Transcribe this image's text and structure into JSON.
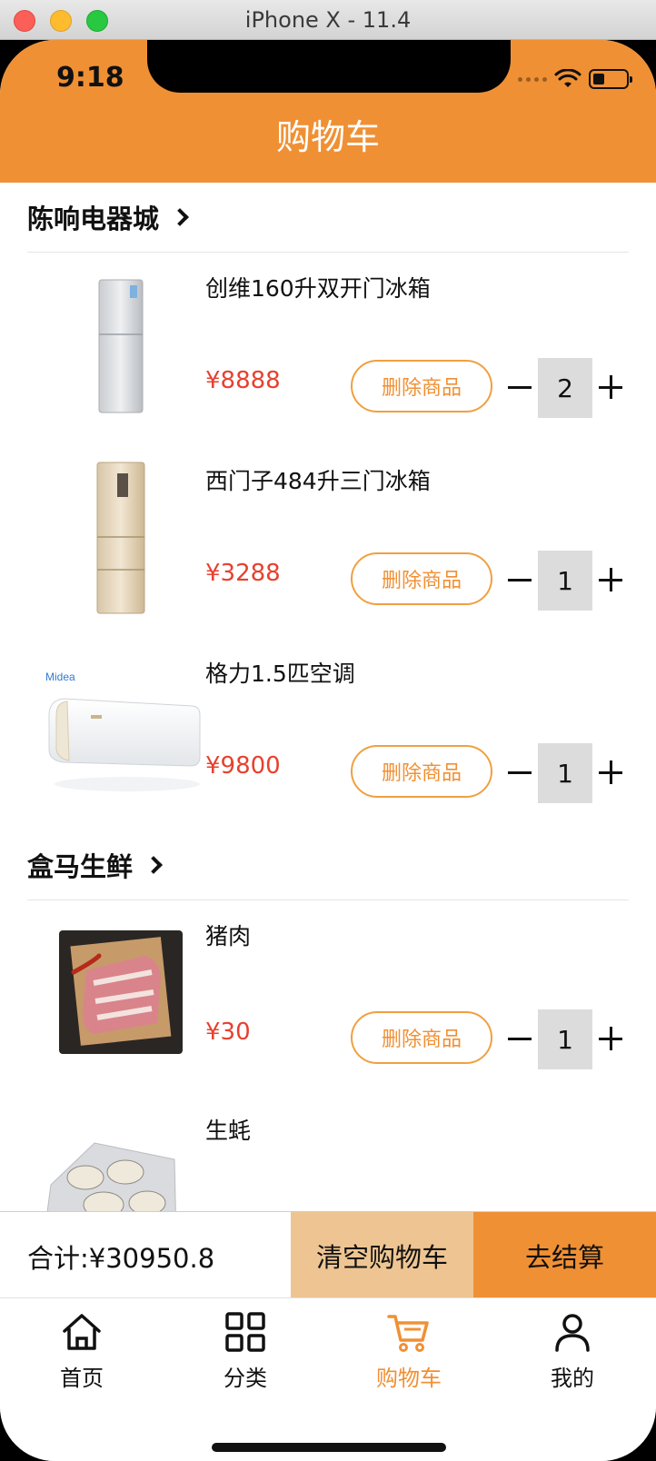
{
  "window": {
    "title": "iPhone X - 11.4"
  },
  "status_bar": {
    "time": "9:18"
  },
  "header": {
    "title": "购物车"
  },
  "shops": [
    {
      "name": "陈响电器城",
      "items": [
        {
          "title": "创维160升双开门冰箱",
          "price": "¥8888",
          "delete_label": "删除商品",
          "quantity": "2",
          "image": "fridge-2door"
        },
        {
          "title": "西门子484升三门冰箱",
          "price": "¥3288",
          "delete_label": "删除商品",
          "quantity": "1",
          "image": "fridge-3door"
        },
        {
          "title": "格力1.5匹空调",
          "price": "¥9800",
          "delete_label": "删除商品",
          "quantity": "1",
          "image": "air-conditioner",
          "brand_text": "Midea"
        }
      ]
    },
    {
      "name": "盒马生鲜",
      "items": [
        {
          "title": "猪肉",
          "price": "¥30",
          "delete_label": "删除商品",
          "quantity": "1",
          "image": "pork"
        },
        {
          "title": "生蚝",
          "image": "oysters"
        }
      ]
    }
  ],
  "summary": {
    "total": "合计:¥30950.8",
    "clear_label": "清空购物车",
    "checkout_label": "去结算"
  },
  "tabbar": {
    "items": [
      {
        "label": "首页",
        "icon": "home-icon"
      },
      {
        "label": "分类",
        "icon": "grid-icon"
      },
      {
        "label": "购物车",
        "icon": "cart-icon",
        "active": true
      },
      {
        "label": "我的",
        "icon": "user-icon"
      }
    ]
  },
  "colors": {
    "accent": "#f09034",
    "price": "#e8402f",
    "clear_bg": "#eec592"
  }
}
